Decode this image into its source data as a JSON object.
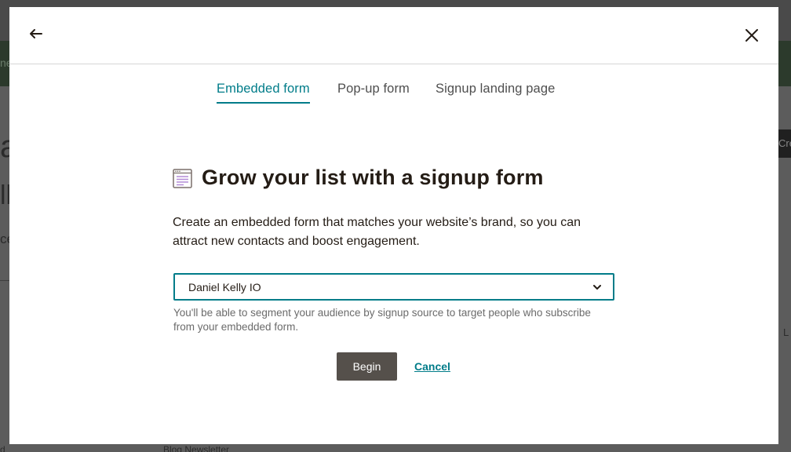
{
  "background": {
    "fragments": [
      "ne",
      "a",
      "ll",
      "ce",
      "Cre",
      "L",
      "d",
      "Blog Newsletter"
    ]
  },
  "modal": {
    "back_icon": "arrow-left-icon",
    "close_icon": "close-icon",
    "tabs": [
      {
        "label": "Embedded form",
        "active": true
      },
      {
        "label": "Pop-up form",
        "active": false
      },
      {
        "label": "Signup landing page",
        "active": false
      }
    ],
    "form_icon": "form-icon",
    "heading": "Grow your list with a signup form",
    "description": "Create an embedded form that matches your website’s brand, so you can attract new contacts and boost engagement.",
    "audience_select": {
      "value": "Daniel Kelly IO"
    },
    "helper_text": "You'll be able to segment your audience by signup source to target people who subscribe from your embedded form.",
    "begin_label": "Begin",
    "cancel_label": "Cancel"
  },
  "colors": {
    "accent": "#007c89",
    "primary_button": "#55504b",
    "text": "#241c15"
  }
}
